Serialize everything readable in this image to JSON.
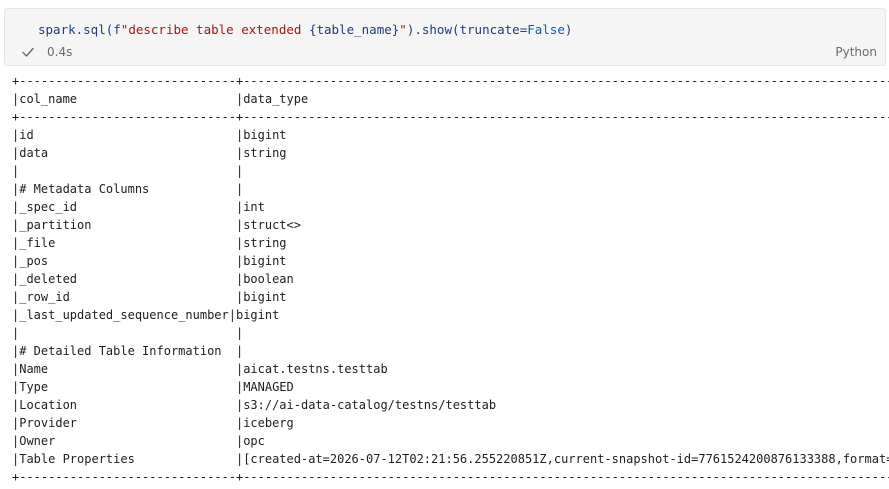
{
  "cell": {
    "code": {
      "fn": "spark.sql(",
      "prefix": "f",
      "str1": "\"describe table extended ",
      "brace_open": "{",
      "var": "table_name",
      "brace_close": "}",
      "str2": "\"",
      "close": ").show(",
      "param": "truncate=",
      "const": "False",
      "end": ")"
    },
    "exec_time": "0.4s",
    "language": "Python"
  },
  "output": {
    "separator": "+------------------------------+----------------------------------------------------------------------------------------------------------------",
    "header": "|col_name                      |data_type",
    "rows": [
      "|id                            |bigint",
      "|data                          |string",
      "|                              |",
      "|# Metadata Columns            |",
      "|_spec_id                      |int",
      "|_partition                    |struct<>",
      "|_file                         |string",
      "|_pos                          |bigint",
      "|_deleted                      |boolean",
      "|_row_id                       |bigint",
      "|_last_updated_sequence_number|bigint",
      "|                              |",
      "|# Detailed Table Information  |",
      "|Name                          |aicat.testns.testtab",
      "|Type                          |MANAGED",
      "|Location                      |s3://ai-data-catalog/testns/testtab",
      "|Provider                      |iceberg",
      "|Owner                         |opc",
      "|Table Properties              |[created-at=2026-07-12T02:21:56.255220851Z,current-snapshot-id=7761524200876133388,format="
    ]
  },
  "icons": {
    "status": "check-icon"
  },
  "colors": {
    "cell_bg": "#f5f5f5",
    "code_text": "#1f3c78",
    "string": "#a31515",
    "constant": "#0b5cad",
    "status_text": "#6b6b6b",
    "check": "#2e7d32"
  }
}
